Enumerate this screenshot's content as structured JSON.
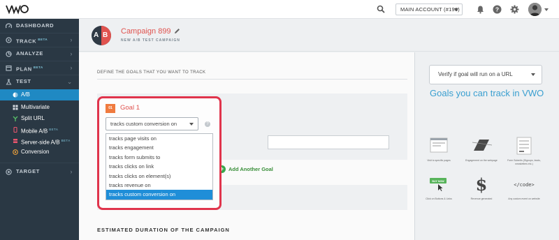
{
  "topbar": {
    "account_label": "MAIN ACCOUNT (#196)"
  },
  "sidebar": {
    "items": [
      {
        "label": "DASHBOARD",
        "icon": "dashboard-icon"
      },
      {
        "label": "TRACK",
        "badge": "BETA",
        "icon": "track-icon"
      },
      {
        "label": "ANALYZE",
        "icon": "analyze-icon"
      },
      {
        "label": "PLAN",
        "badge": "BETA",
        "icon": "plan-icon"
      },
      {
        "label": "TEST",
        "icon": "test-icon"
      },
      {
        "label": "TARGET",
        "icon": "target-icon"
      }
    ],
    "test_subitems": [
      {
        "label": "A/B"
      },
      {
        "label": "Multivariate"
      },
      {
        "label": "Split URL"
      },
      {
        "label": "Mobile A/B",
        "badge": "BETA"
      },
      {
        "label": "Server-side A/B",
        "badge": "BETA"
      },
      {
        "label": "Conversion"
      }
    ]
  },
  "header": {
    "badge_a": "A",
    "badge_b": "B",
    "campaign_title": "Campaign 899",
    "campaign_subtitle": "NEW A/B TEST CAMPAIGN"
  },
  "main": {
    "define_heading": "DEFINE THE GOALS THAT YOU WANT TO TRACK",
    "add_goal_label": "Add Another Goal",
    "estimated_heading": "ESTIMATED DURATION OF THE CAMPAIGN"
  },
  "goal": {
    "number": "01",
    "title": "Goal 1",
    "selected_value": "tracks custom conversion on",
    "options": [
      "tracks page visits on",
      "tracks engagement",
      "tracks form submits to",
      "tracks clicks on link",
      "tracks clicks on element(s)",
      "tracks revenue on",
      "tracks custom conversion on"
    ],
    "selected_index": 6
  },
  "right_panel": {
    "verify_label": "Verify if goal will run on a URL",
    "goals_heading": "Goals you can track in VWO",
    "thumbs": [
      {
        "caption": "Visit to specific pages"
      },
      {
        "caption": "Engagement on the webpage"
      },
      {
        "caption": "Form Submits (Signups, leads, newsletters etc.)"
      },
      {
        "caption": "Click on Buttons & Links",
        "button_text": "BUY NOW"
      },
      {
        "caption": "Revenue generated",
        "symbol": "$"
      },
      {
        "caption": "Any custom event on website",
        "symbol": "</code>"
      }
    ]
  },
  "colors": {
    "sidebar_bg": "#2a3844",
    "active_blue": "#1f89c3",
    "accent_red": "#e0534f",
    "highlight_red": "#e0344c",
    "add_green": "#3aa64c",
    "heading_blue": "#3a9fd0"
  }
}
